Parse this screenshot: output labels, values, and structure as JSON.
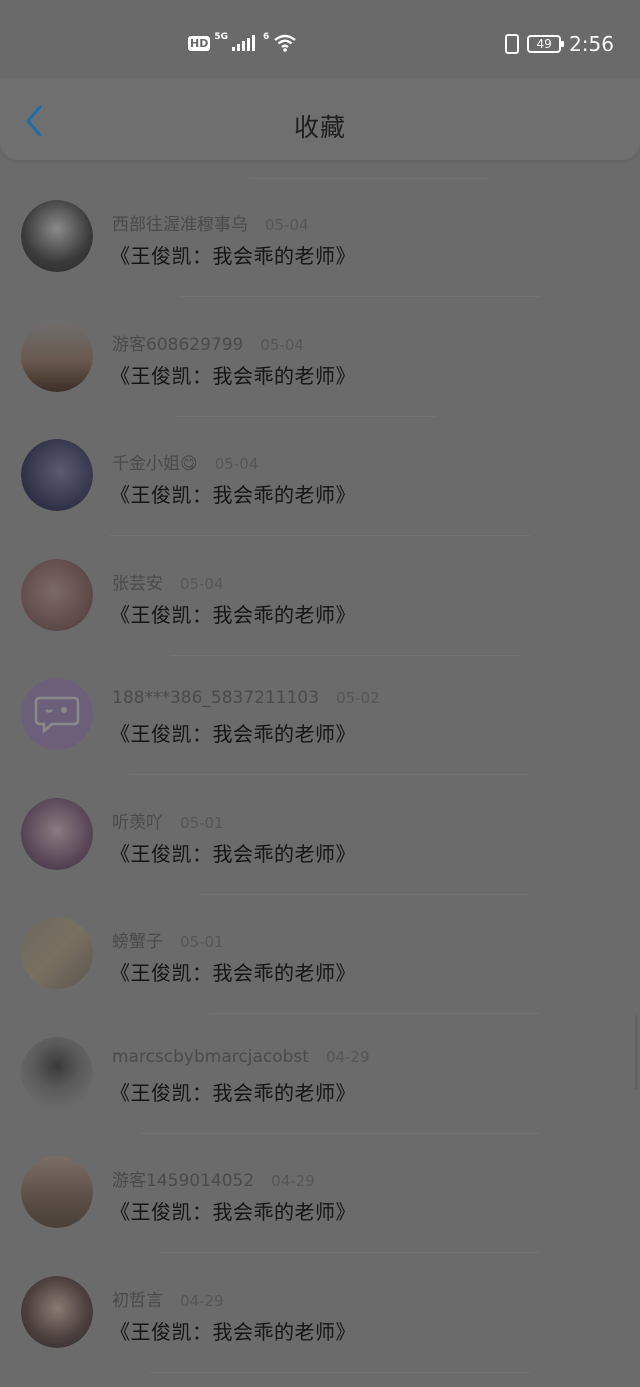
{
  "status_bar": {
    "hd_label": "HD",
    "network_label": "5G",
    "wifi_label": "6",
    "battery": "49",
    "time": "2:56"
  },
  "header": {
    "title": "收藏"
  },
  "items": [
    {
      "user": "西部往渥准穆事乌",
      "date": "05-04",
      "title": "《王俊凯：我会乖的老师》"
    },
    {
      "user": "游客608629799",
      "date": "05-04",
      "title": "《王俊凯：我会乖的老师》"
    },
    {
      "user": "千金小姐😋",
      "date": "05-04",
      "title": "《王俊凯：我会乖的老师》"
    },
    {
      "user": "张芸安",
      "date": "05-04",
      "title": "《王俊凯：我会乖的老师》"
    },
    {
      "user": "188***386_5837211103",
      "date": "05-02",
      "title": "《王俊凯：我会乖的老师》"
    },
    {
      "user": "听羡吖",
      "date": "05-01",
      "title": "《王俊凯：我会乖的老师》"
    },
    {
      "user": "螃蟹子",
      "date": "05-01",
      "title": "《王俊凯：我会乖的老师》"
    },
    {
      "user": "marcscbybmarcjacobst",
      "date": "04-29",
      "title": "《王俊凯：我会乖的老师》"
    },
    {
      "user": "游客1459014052",
      "date": "04-29",
      "title": "《王俊凯：我会乖的老师》"
    },
    {
      "user": "初哲言",
      "date": "04-29",
      "title": "《王俊凯：我会乖的老师》"
    }
  ],
  "colors": {
    "overlay": "#6b6b6b",
    "back_accent": "#1a6fa8"
  }
}
